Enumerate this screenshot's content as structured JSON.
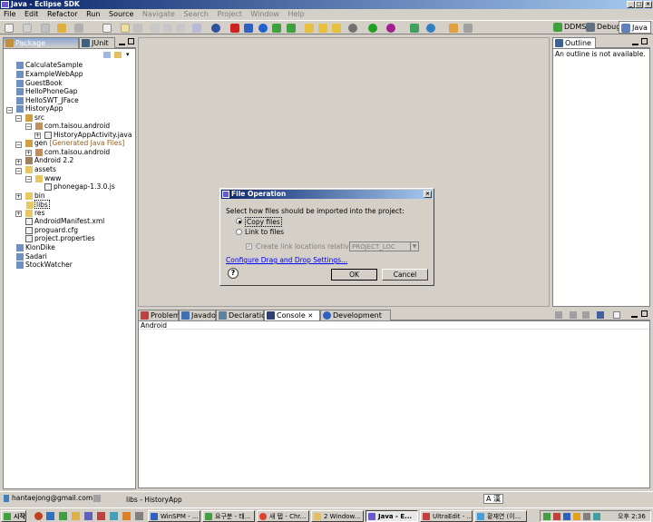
{
  "window": {
    "title": "Java - Eclipse SDK"
  },
  "menu": [
    "File",
    "Edit",
    "Refactor",
    "Run",
    "Source",
    "Navigate",
    "Search",
    "Project",
    "Window",
    "Help"
  ],
  "perspectives": {
    "ddms": "DDMS",
    "debug": "Debug",
    "java": "Java"
  },
  "left_panel": {
    "tabs": [
      "Package Explorer",
      "JUnit"
    ],
    "tree": [
      {
        "label": "CalculateSample"
      },
      {
        "label": "ExampleWebApp"
      },
      {
        "label": "GuestBook"
      },
      {
        "label": "HelloPhoneGap"
      },
      {
        "label": "HelloSWT_JFace"
      },
      {
        "label": "HistoryApp"
      },
      {
        "label": "src"
      },
      {
        "label": "com.taisou.android"
      },
      {
        "label": "HistoryAppActivity.java"
      },
      {
        "label": "gen",
        "suffix": "[Generated Java Files]"
      },
      {
        "label": "com.taisou.android"
      },
      {
        "label": "Android 2.2"
      },
      {
        "label": "assets"
      },
      {
        "label": "www"
      },
      {
        "label": "phonegap-1.3.0.js"
      },
      {
        "label": "bin"
      },
      {
        "label": "libs"
      },
      {
        "label": "res"
      },
      {
        "label": "AndroidManifest.xml"
      },
      {
        "label": "proguard.cfg"
      },
      {
        "label": "project.properties"
      },
      {
        "label": "KlonDike"
      },
      {
        "label": "Sadari"
      },
      {
        "label": "StockWatcher"
      }
    ]
  },
  "outline": {
    "tab": "Outline",
    "message": "An outline is not available."
  },
  "bottom_panel": {
    "tabs": [
      "Problems",
      "Javadoc",
      "Declaration",
      "Console",
      "Development Mode"
    ],
    "console_title": "Android"
  },
  "dialog": {
    "title": "File Operation",
    "prompt": "Select how files should be imported into the project:",
    "option_copy": "Copy files",
    "option_link": "Link to files",
    "checkbox_label": "Create link locations relative to:",
    "combo_value": "PROJECT_LOC",
    "link": "Configure Drag and Drop Settings...",
    "ok": "OK",
    "cancel": "Cancel"
  },
  "status": {
    "user": "hantaejong@gmail.com",
    "selection": "libs - HistoryApp",
    "ime": "A 漢"
  },
  "taskbar": {
    "start": "시작",
    "items": [
      "WinSPM - ...",
      "요구분 - 태...",
      "새 탭 - Chr...",
      "2 Window...",
      "Java - E...",
      "UltraEdit - ...",
      "황재연 (이..."
    ],
    "clock": "오후 2:36"
  },
  "colors": {
    "title_start": "#0a246a",
    "title_end": "#a6caf0",
    "link": "#0000ff"
  }
}
